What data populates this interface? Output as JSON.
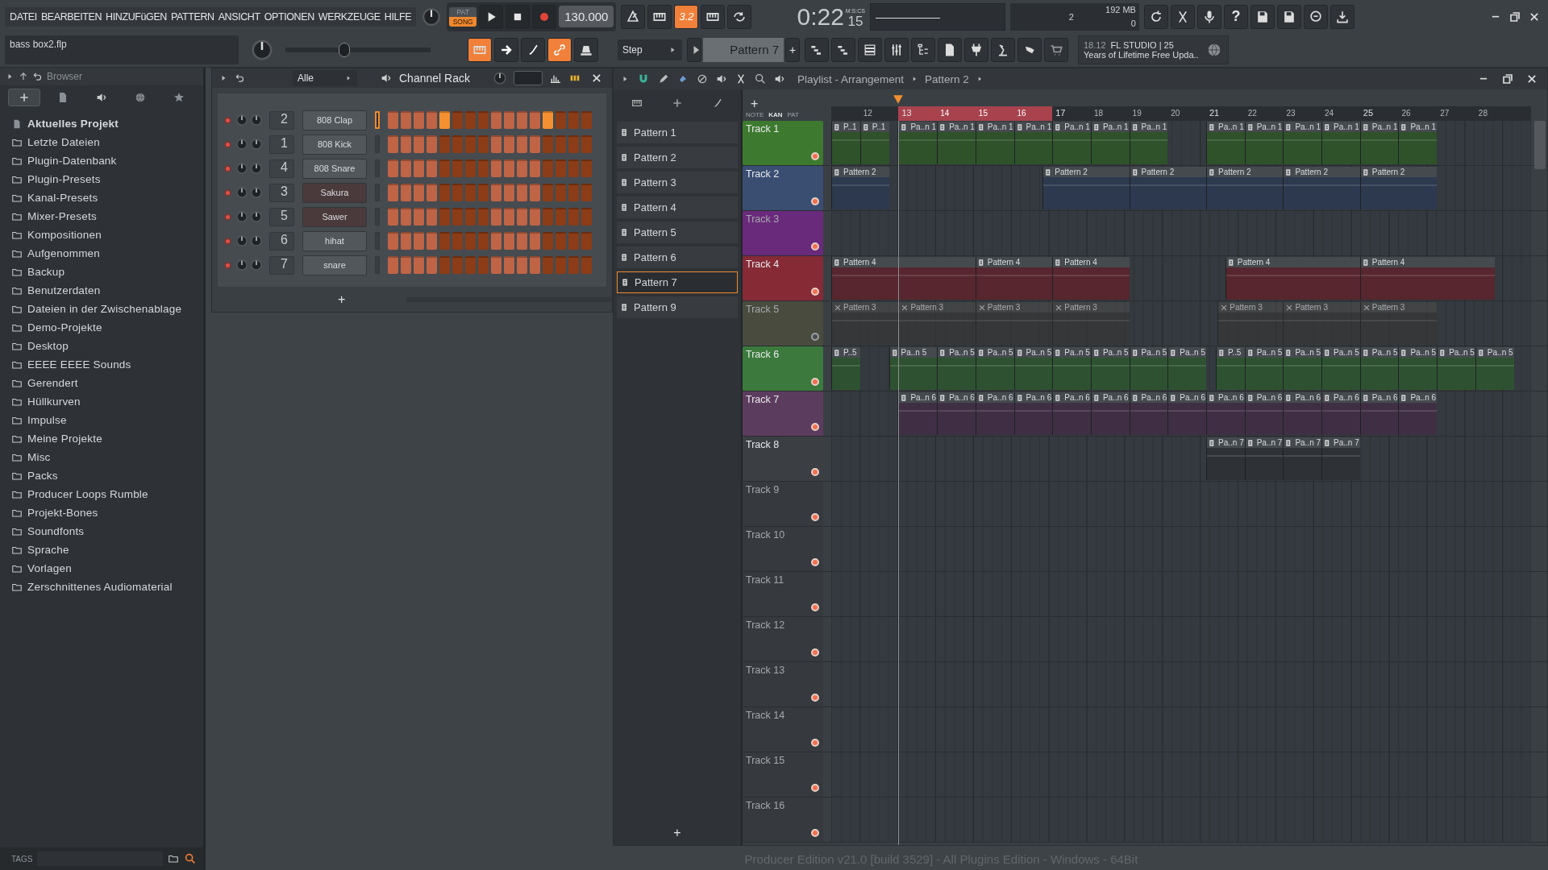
{
  "menu": [
    "DATEI",
    "BEARBEITEN",
    "HINZUFüGEN",
    "PATTERN",
    "ANSICHT",
    "OPTIONEN",
    "WERKZEUGE",
    "HILFE"
  ],
  "transport": {
    "modes": [
      {
        "label": "PAT",
        "selected": false
      },
      {
        "label": "SONG",
        "selected": true
      }
    ],
    "tempo": "130.000",
    "countdown": "3.2",
    "time_format": "M:S:CS",
    "time": "0:22",
    "time_cs": "15"
  },
  "monitor": {
    "voices": "2",
    "memory": "192 MB",
    "cpu": "0"
  },
  "help": "?",
  "project": {
    "file": "bass box2.flp"
  },
  "master_slider": {
    "level": 0.4
  },
  "snap": "Step",
  "pattern_selector": {
    "value": "Pattern 7",
    "add": "+"
  },
  "news": {
    "version": "18.12",
    "title": "FL STUDIO | 25",
    "message": "Years of Lifetime Free Upda.."
  },
  "browser": {
    "title": "Browser",
    "tabs": [
      {
        "selected": true
      },
      {
        "selected": false
      },
      {
        "selected": false
      },
      {
        "selected": false
      },
      {
        "selected": false
      }
    ],
    "items": [
      "Aktuelles Projekt",
      "Letzte Dateien",
      "Plugin-Datenbank",
      "Plugin-Presets",
      "Kanal-Presets",
      "Mixer-Presets",
      "Kompositionen",
      "Aufgenommen",
      "Backup",
      "Benutzerdaten",
      "Dateien in der Zwischenablage",
      "Demo-Projekte",
      "Desktop",
      "EEEE EEEE Sounds",
      "Gerendert",
      "Hüllkurven",
      "Impulse",
      "Meine Projekte",
      "Misc",
      "Packs",
      "Producer Loops Rumble",
      "Projekt-Bones",
      "Soundfonts",
      "Sprache",
      "Vorlagen",
      "Zerschnittenes Audiomaterial"
    ],
    "tags_label": "TAGS"
  },
  "channel_rack": {
    "title": "Channel Rack",
    "filter": "Alle",
    "add": "+",
    "channels": [
      {
        "number": "2",
        "name": "808 Clap",
        "kind": "sampler",
        "selected": true,
        "steps": [
          false,
          false,
          false,
          false,
          true,
          false,
          false,
          false,
          false,
          false,
          false,
          false,
          true,
          false,
          false,
          false
        ]
      },
      {
        "number": "1",
        "name": "808 Kick",
        "kind": "sampler",
        "selected": false,
        "steps": [
          false,
          false,
          false,
          false,
          false,
          false,
          false,
          false,
          false,
          false,
          false,
          false,
          false,
          false,
          false,
          false
        ]
      },
      {
        "number": "4",
        "name": "808 Snare",
        "kind": "sampler",
        "selected": false,
        "steps": [
          false,
          false,
          false,
          false,
          false,
          false,
          false,
          false,
          false,
          false,
          false,
          false,
          false,
          false,
          false,
          false
        ]
      },
      {
        "number": "3",
        "name": "Sakura",
        "kind": "synth",
        "selected": false,
        "steps": [
          false,
          false,
          false,
          false,
          false,
          false,
          false,
          false,
          false,
          false,
          false,
          false,
          false,
          false,
          false,
          false
        ]
      },
      {
        "number": "5",
        "name": "Sawer",
        "kind": "synth",
        "selected": false,
        "steps": [
          false,
          false,
          false,
          false,
          false,
          false,
          false,
          false,
          false,
          false,
          false,
          false,
          false,
          false,
          false,
          false
        ]
      },
      {
        "number": "6",
        "name": "hihat",
        "kind": "sampler",
        "selected": false,
        "steps": [
          false,
          false,
          false,
          false,
          false,
          false,
          false,
          false,
          false,
          false,
          false,
          false,
          false,
          false,
          false,
          false
        ]
      },
      {
        "number": "7",
        "name": "snare",
        "kind": "sampler",
        "selected": false,
        "steps": [
          false,
          false,
          false,
          false,
          false,
          false,
          false,
          false,
          false,
          false,
          false,
          false,
          false,
          false,
          false,
          false
        ]
      }
    ]
  },
  "playlist": {
    "title": "Playlist - Arrangement",
    "pattern": "Pattern 2",
    "add_pattern": "+",
    "add_track": "+",
    "view_modes": [
      {
        "label": "NOTE",
        "selected": false
      },
      {
        "label": "KAN",
        "selected": true
      },
      {
        "label": "PAT",
        "selected": false
      }
    ],
    "patterns": [
      {
        "label": "Pattern 1",
        "selected": false
      },
      {
        "label": "Pattern 2",
        "selected": false
      },
      {
        "label": "Pattern 3",
        "selected": false
      },
      {
        "label": "Pattern 4",
        "selected": false
      },
      {
        "label": "Pattern 5",
        "selected": false
      },
      {
        "label": "Pattern 6",
        "selected": false
      },
      {
        "label": "Pattern 7",
        "selected": true
      },
      {
        "label": "Pattern 9",
        "selected": false
      }
    ],
    "ruler": [
      {
        "label": "12",
        "selected": false
      },
      {
        "label": "13",
        "selected": true
      },
      {
        "label": "14",
        "selected": true
      },
      {
        "label": "15",
        "selected": true
      },
      {
        "label": "16",
        "selected": true
      },
      {
        "label": "17",
        "selected": false
      },
      {
        "label": "18",
        "selected": false
      },
      {
        "label": "19",
        "selected": false
      },
      {
        "label": "20",
        "selected": false
      },
      {
        "label": "21",
        "selected": false
      },
      {
        "label": "22",
        "selected": false
      },
      {
        "label": "23",
        "selected": false
      },
      {
        "label": "24",
        "selected": false
      },
      {
        "label": "25",
        "selected": false
      },
      {
        "label": "26",
        "selected": false
      },
      {
        "label": "27",
        "selected": false
      },
      {
        "label": "28",
        "selected": false
      }
    ],
    "tracks": [
      {
        "name": "Track 1",
        "color": "#3d7a2f",
        "muted": false,
        "clips": [
          "P..1",
          "P..1",
          "Pa..n 1",
          "Pa..n 1",
          "Pa..n 1",
          "Pa..n 1",
          "Pa..n 1",
          "Pa..n 1",
          "Pa..n 1",
          "Pa..n 1",
          "Pa..n 1",
          "Pa..n 1",
          "Pa..n 1",
          "Pa..n 1",
          "Pa..n 1"
        ]
      },
      {
        "name": "Track 2",
        "color": "#3a4e72",
        "muted": false,
        "clips": [
          "Pattern 2",
          "Pattern 2",
          "Pattern 2",
          "Pattern 2",
          "Pattern 2",
          "Pattern 2"
        ]
      },
      {
        "name": "Track 3",
        "color": "#6a2a7c",
        "muted": false
      },
      {
        "name": "Track 4",
        "color": "#862a36",
        "muted": false,
        "clips": [
          "Pattern 4",
          "Pattern 4",
          "Pattern 4",
          "Pattern 4",
          "Pattern 4"
        ]
      },
      {
        "name": "Track 5",
        "color": "#484b3e",
        "muted": true,
        "clips": [
          "Pattern 3",
          "Pattern 3",
          "Pattern 3",
          "Pattern 3",
          "Pattern 3",
          "Pattern 3",
          "Pattern 3"
        ]
      },
      {
        "name": "Track 6",
        "color": "#3b7a3c",
        "muted": false,
        "clips": [
          "P..5",
          "Pa..n 5",
          "Pa..n 5",
          "Pa..n 5",
          "Pa..n 5",
          "Pa..n 5",
          "Pa..n 5",
          "Pa..n 5",
          "Pa..n 5",
          "P..5",
          "Pa..n 5",
          "Pa..n 5",
          "Pa..n 5",
          "Pa..n 5",
          "Pa..n 5",
          "Pa..n 5",
          "Pa..n 5"
        ]
      },
      {
        "name": "Track 7",
        "color": "#5c3c5e",
        "muted": false,
        "clips": [
          "Pa..n 6",
          "Pa..n 6",
          "Pa..n 6",
          "Pa..n 6",
          "Pa..n 6",
          "Pa..n 6",
          "Pa..n 6",
          "Pa..n 6",
          "Pa..n 6",
          "Pa..n 6",
          "Pa..n 6",
          "Pa..n 6",
          "Pa..n 6",
          "Pa..n 6"
        ]
      },
      {
        "name": "Track 8",
        "color": "#3b3f44",
        "muted": false,
        "clips": [
          "Pa..n 7",
          "Pa..n 7",
          "Pa..n 7",
          "Pa..n 7"
        ]
      },
      {
        "name": "Track 9",
        "color": "#363a3e",
        "muted": false
      },
      {
        "name": "Track 10",
        "color": "#363a3e",
        "muted": false
      },
      {
        "name": "Track 11",
        "color": "#363a3e",
        "muted": false
      },
      {
        "name": "Track 12",
        "color": "#363a3e",
        "muted": false
      },
      {
        "name": "Track 13",
        "color": "#363a3e",
        "muted": false
      },
      {
        "name": "Track 14",
        "color": "#363a3e",
        "muted": false
      },
      {
        "name": "Track 15",
        "color": "#363a3e",
        "muted": false
      },
      {
        "name": "Track 16",
        "color": "#363a3e",
        "muted": false
      }
    ]
  },
  "status": "Producer Edition v21.0 [build 3529] - All Plugins Edition - Windows - 64Bit"
}
